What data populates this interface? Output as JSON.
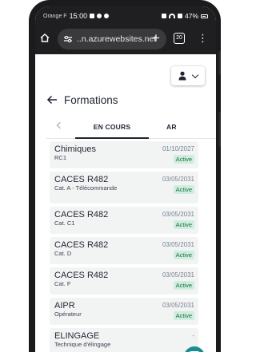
{
  "statusbar": {
    "carrier": "Orange F",
    "time": "15:00",
    "battery": "47%"
  },
  "browser": {
    "url": "..n.azurewebsites.net",
    "tab_count": "20"
  },
  "page": {
    "title": "Formations"
  },
  "tabs": [
    {
      "label": "EN COURS",
      "active": true
    },
    {
      "label": "AR"
    }
  ],
  "formations": [
    {
      "name": "Chimiques",
      "sub": "RC1",
      "date": "01/10/2027",
      "status": "Active"
    },
    {
      "name": "CACES R482",
      "sub": "Cat. A - Télécommande",
      "date": "03/05/2031",
      "status": "Active"
    },
    {
      "name": "CACES R482",
      "sub": "Cat. C1",
      "date": "03/05/2031",
      "status": "Active"
    },
    {
      "name": "CACES R482",
      "sub": "Cat. D",
      "date": "03/05/2031",
      "status": "Active"
    },
    {
      "name": "CACES R482",
      "sub": "Cat. F",
      "date": "03/05/2031",
      "status": "Active"
    },
    {
      "name": "AIPR",
      "sub": "Opérateur",
      "date": "03/05/2031",
      "status": "Active"
    },
    {
      "name": "ELINGAGE",
      "sub": "Technique d'élingage",
      "date": "-",
      "status": ""
    }
  ],
  "colors": {
    "accent": "#1f2430",
    "badge_bg": "#cfeedd",
    "badge_text": "#1f6b47",
    "fab": "#1a8e8e"
  }
}
